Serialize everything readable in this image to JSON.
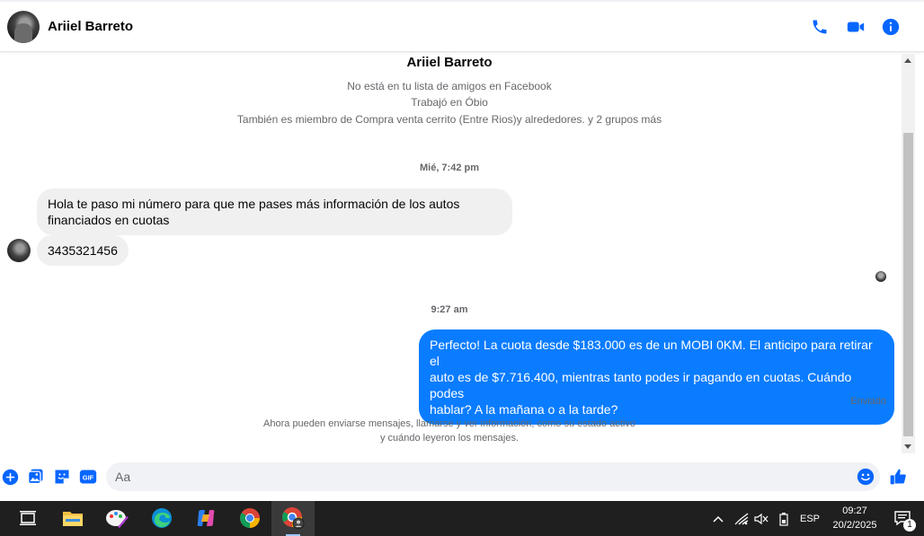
{
  "header": {
    "contact_name": "Ariiel Barreto",
    "actions": [
      "phone-icon",
      "video-camera-icon",
      "info-icon"
    ],
    "accent_color": "#0866ff"
  },
  "profile": {
    "name": "Ariiel Barreto",
    "line1": "No está en tu lista de amigos en Facebook",
    "line2": "Trabajó en Óbio",
    "line3": "También es miembro de Compra venta cerrito (Entre Rios)y alrededores. y 2 grupos más"
  },
  "messages": [
    {
      "timestamp": "Mié, 7:42 pm"
    },
    {
      "direction": "incoming",
      "text_line1": "Hola te paso mi número para que me pases más información de los autos",
      "text_line2": "financiados en cuotas"
    },
    {
      "direction": "incoming",
      "text": "3435321456"
    },
    {
      "timestamp": "9:27 am"
    },
    {
      "direction": "outgoing",
      "text_line1": "Perfecto! La cuota desde $183.000 es de un MOBI 0KM. El anticipo para retirar el",
      "text_line2": "auto es de $7.716.400, mientras tanto podes ir pagando en cuotas. Cuándo podes",
      "text_line3": "hablar? A la mañana o a la tarde?"
    }
  ],
  "sent_status": "Enviado",
  "footer_note": {
    "line1": "Ahora pueden enviarse mensajes, llamarse y ver información, como su estado activo",
    "line2": "y cuándo leyeron los mensajes."
  },
  "composer": {
    "placeholder": "Aa",
    "left_icons": [
      "plus-icon",
      "photo-icon",
      "sticker-icon",
      "gif-icon"
    ],
    "gif_label": "GIF",
    "right_icons": [
      "emoji-icon",
      "thumbs-up-icon"
    ],
    "outgoing_color": "#0a7cff"
  },
  "taskbar": {
    "apps": [
      "task-view-icon",
      "file-explorer-icon",
      "paint-icon",
      "edge-icon",
      "copilot-icon",
      "chrome-icon",
      "chrome-profile-icon"
    ],
    "tray": {
      "language": "ESP",
      "time": "09:27",
      "date": "20/2/2025",
      "notification_count": "1"
    }
  }
}
